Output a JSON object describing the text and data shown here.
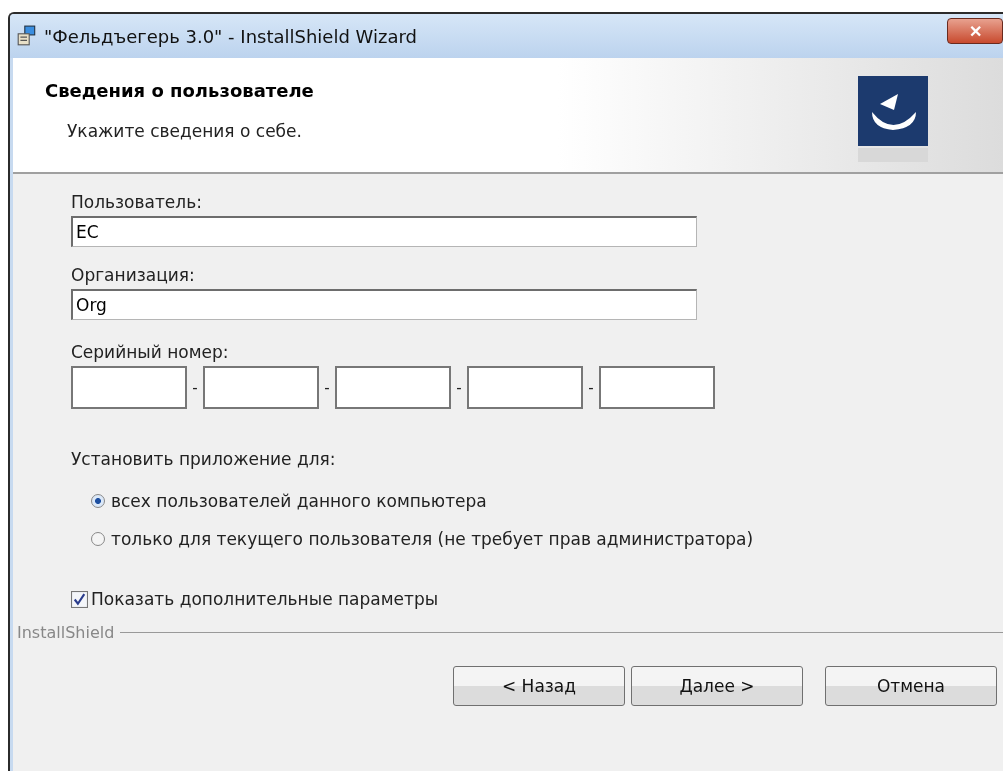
{
  "window": {
    "title": "\"Фельдъегерь 3.0\" - InstallShield Wizard",
    "close": "✕"
  },
  "header": {
    "title": "Сведения о пользователе",
    "subtitle": "Укажите сведения о себе."
  },
  "user": {
    "label": "Пользователь:",
    "value": "EC"
  },
  "organization": {
    "label": "Организация:",
    "value": "Org"
  },
  "serial": {
    "label": "Серийный номер:",
    "fields": [
      {
        "kind": "field"
      },
      {
        "kind": "field"
      },
      {
        "kind": "field"
      },
      {
        "kind": "field"
      },
      {
        "kind": "field"
      }
    ],
    "separators": [
      "-",
      "-",
      "-",
      "-"
    ]
  },
  "install_for": {
    "label": "Установить приложение для:",
    "options": [
      {
        "label": "всех пользователей данного компьютера",
        "selected": true
      },
      {
        "label": "только для текущего пользователя (не требует прав администратора)",
        "selected": false
      }
    ]
  },
  "show_advanced": {
    "label": "Показать дополнительные параметры",
    "checked": true
  },
  "brand": "InstallShield",
  "buttons": [
    {
      "label": "< Назад"
    },
    {
      "label": "Далее >"
    },
    {
      "label": "Отмена"
    }
  ]
}
